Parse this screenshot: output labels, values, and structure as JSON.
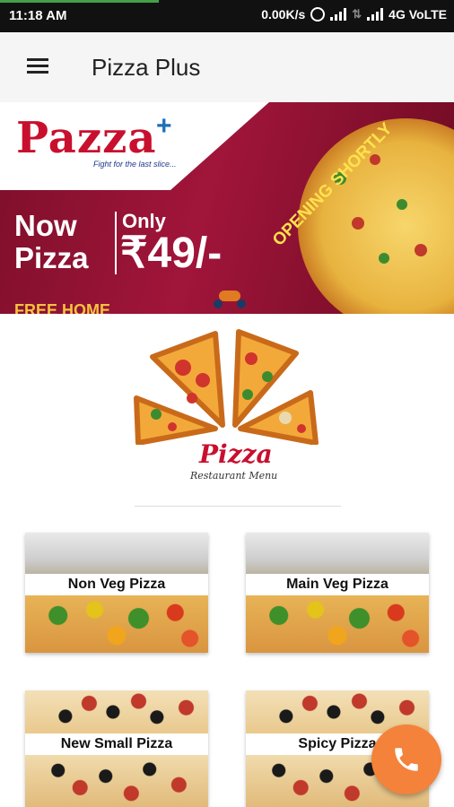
{
  "status_bar": {
    "time": "11:18 AM",
    "speed": "0.00K/s",
    "network": "4G VoLTE",
    "progress_fraction": 0.35,
    "progress_color": "#43a047"
  },
  "app_bar": {
    "title": "Pizza Plus",
    "menu_icon": "hamburger-menu-icon"
  },
  "banner": {
    "brand": "Pazza",
    "brand_plus": "+",
    "tagline": "Fight for the last slice...",
    "headline_line1": "Now",
    "headline_line2": "Pizza",
    "only_label": "Only",
    "price": "₹49/-",
    "ribbon": "OPENING SHORTLY",
    "bottom_text": "FREE HOME"
  },
  "menu_logo": {
    "title": "Pizza",
    "subtitle": "Restaurant Menu"
  },
  "categories": [
    {
      "label": "Non Veg Pizza"
    },
    {
      "label": "Main Veg Pizza"
    },
    {
      "label": "New Small Pizza"
    },
    {
      "label": "Spicy Pizza"
    }
  ],
  "fab": {
    "icon": "phone-icon",
    "color": "#f4823a"
  },
  "colors": {
    "brand_red": "#c8102e",
    "banner_crimson": "#a1153a",
    "accent_yellow": "#ffe14d"
  }
}
